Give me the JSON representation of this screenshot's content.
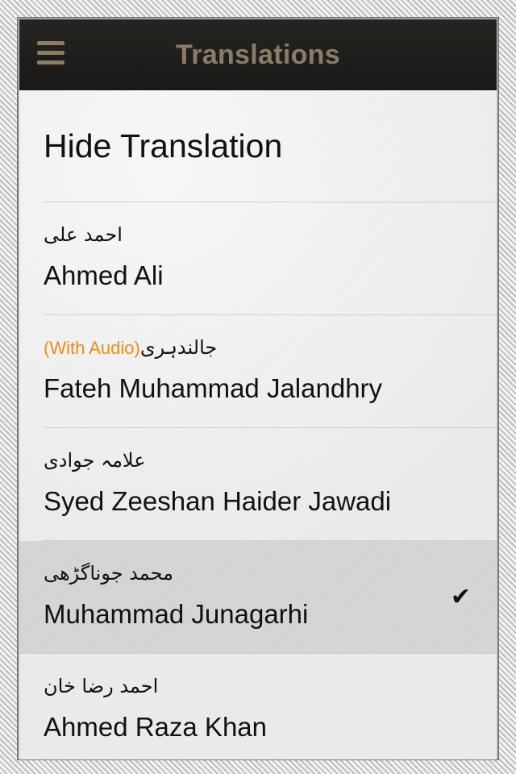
{
  "header": {
    "title": "Translations",
    "menu_icon": "hamburger-menu-icon"
  },
  "hide_translation": {
    "label": "Hide Translation"
  },
  "translations": [
    {
      "urdu": "احمد علی",
      "audio": "",
      "name": "Ahmed Ali",
      "selected": false
    },
    {
      "urdu": "جالندہری",
      "audio": "(With Audio)",
      "name": "Fateh Muhammad Jalandhry",
      "selected": false
    },
    {
      "urdu": "علامہ جوادی",
      "audio": "",
      "name": "Syed Zeeshan Haider Jawadi",
      "selected": false
    },
    {
      "urdu": "محمد جوناگڑھی",
      "audio": "",
      "name": "Muhammad Junagarhi",
      "selected": true
    },
    {
      "urdu": "احمد رضا خان",
      "audio": "",
      "name": "Ahmed Raza Khan",
      "selected": false
    }
  ],
  "check_mark": "✔",
  "colors": {
    "navbar": "#1f1e1b",
    "title": "#8a7d68",
    "audio_accent": "#f08a16",
    "selected_row": "#d6d6d6"
  }
}
